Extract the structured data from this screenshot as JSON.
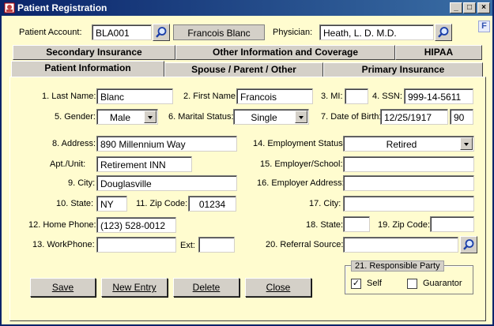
{
  "window": {
    "title": "Patient Registration",
    "minimize_glyph": "_",
    "maximize_glyph": "□",
    "close_glyph": "×"
  },
  "header": {
    "account_label": "Patient Account:",
    "account_value": "BLA001",
    "patient_name": "Francois Blanc",
    "physician_label": "Physician:",
    "physician_value": "Heath, L. D. M.D.",
    "f_icon_text": "F"
  },
  "tabs": {
    "row_back": [
      "Secondary Insurance",
      "Other Information and Coverage",
      "HIPAA"
    ],
    "row_front": [
      "Patient Information",
      "Spouse / Parent / Other",
      "Primary Insurance"
    ],
    "active": "Patient Information"
  },
  "form": {
    "last_name_label": "1. Last Name:",
    "last_name": "Blanc",
    "first_name_label": "2. First Name:",
    "first_name": "Francois",
    "mi_label": "3. MI:",
    "mi": "",
    "ssn_label": "4. SSN:",
    "ssn": "999-14-5611",
    "gender_label": "5. Gender:",
    "gender": "Male",
    "marital_label": "6. Marital Status:",
    "marital": "Single",
    "dob_label": "7. Date of Birth:",
    "dob": "12/25/1917",
    "age": "90",
    "address_label": "8. Address:",
    "address": "890 Millennium Way",
    "apt_label": "Apt./Unit:",
    "apt": "Retirement INN",
    "city_label": "9. City:",
    "city": "Douglasville",
    "state_label": "10. State:",
    "state": "NY",
    "zip_label": "11. Zip Code:",
    "zip": "01234",
    "home_phone_label": "12. Home Phone:",
    "home_phone": "(123) 528-0012",
    "work_phone_label": "13. WorkPhone:",
    "work_phone": "",
    "ext_label": "Ext:",
    "ext": "",
    "employment_label": "14. Employment Status:",
    "employment": "Retired",
    "employer_label": "15. Employer/School:",
    "employer": "",
    "employer_addr_label": "16. Employer Address:",
    "employer_addr": "",
    "emp_city_label": "17. City:",
    "emp_city": "",
    "emp_state_label": "18. State:",
    "emp_state": "",
    "emp_zip_label": "19. Zip Code:",
    "emp_zip": "",
    "referral_label": "20. Referral Source:",
    "referral": ""
  },
  "responsible_party": {
    "title": "21. Responsible Party",
    "self_label": "Self",
    "self_checked": true,
    "self_mark": "✓",
    "guarantor_label": "Guarantor",
    "guarantor_checked": false
  },
  "buttons": {
    "save": "Save",
    "new_entry": "New Entry",
    "delete": "Delete",
    "close": "Close"
  },
  "colors": {
    "background": "#fffccf",
    "titlebar": "#0a246a",
    "control_face": "#d4d0c8"
  }
}
